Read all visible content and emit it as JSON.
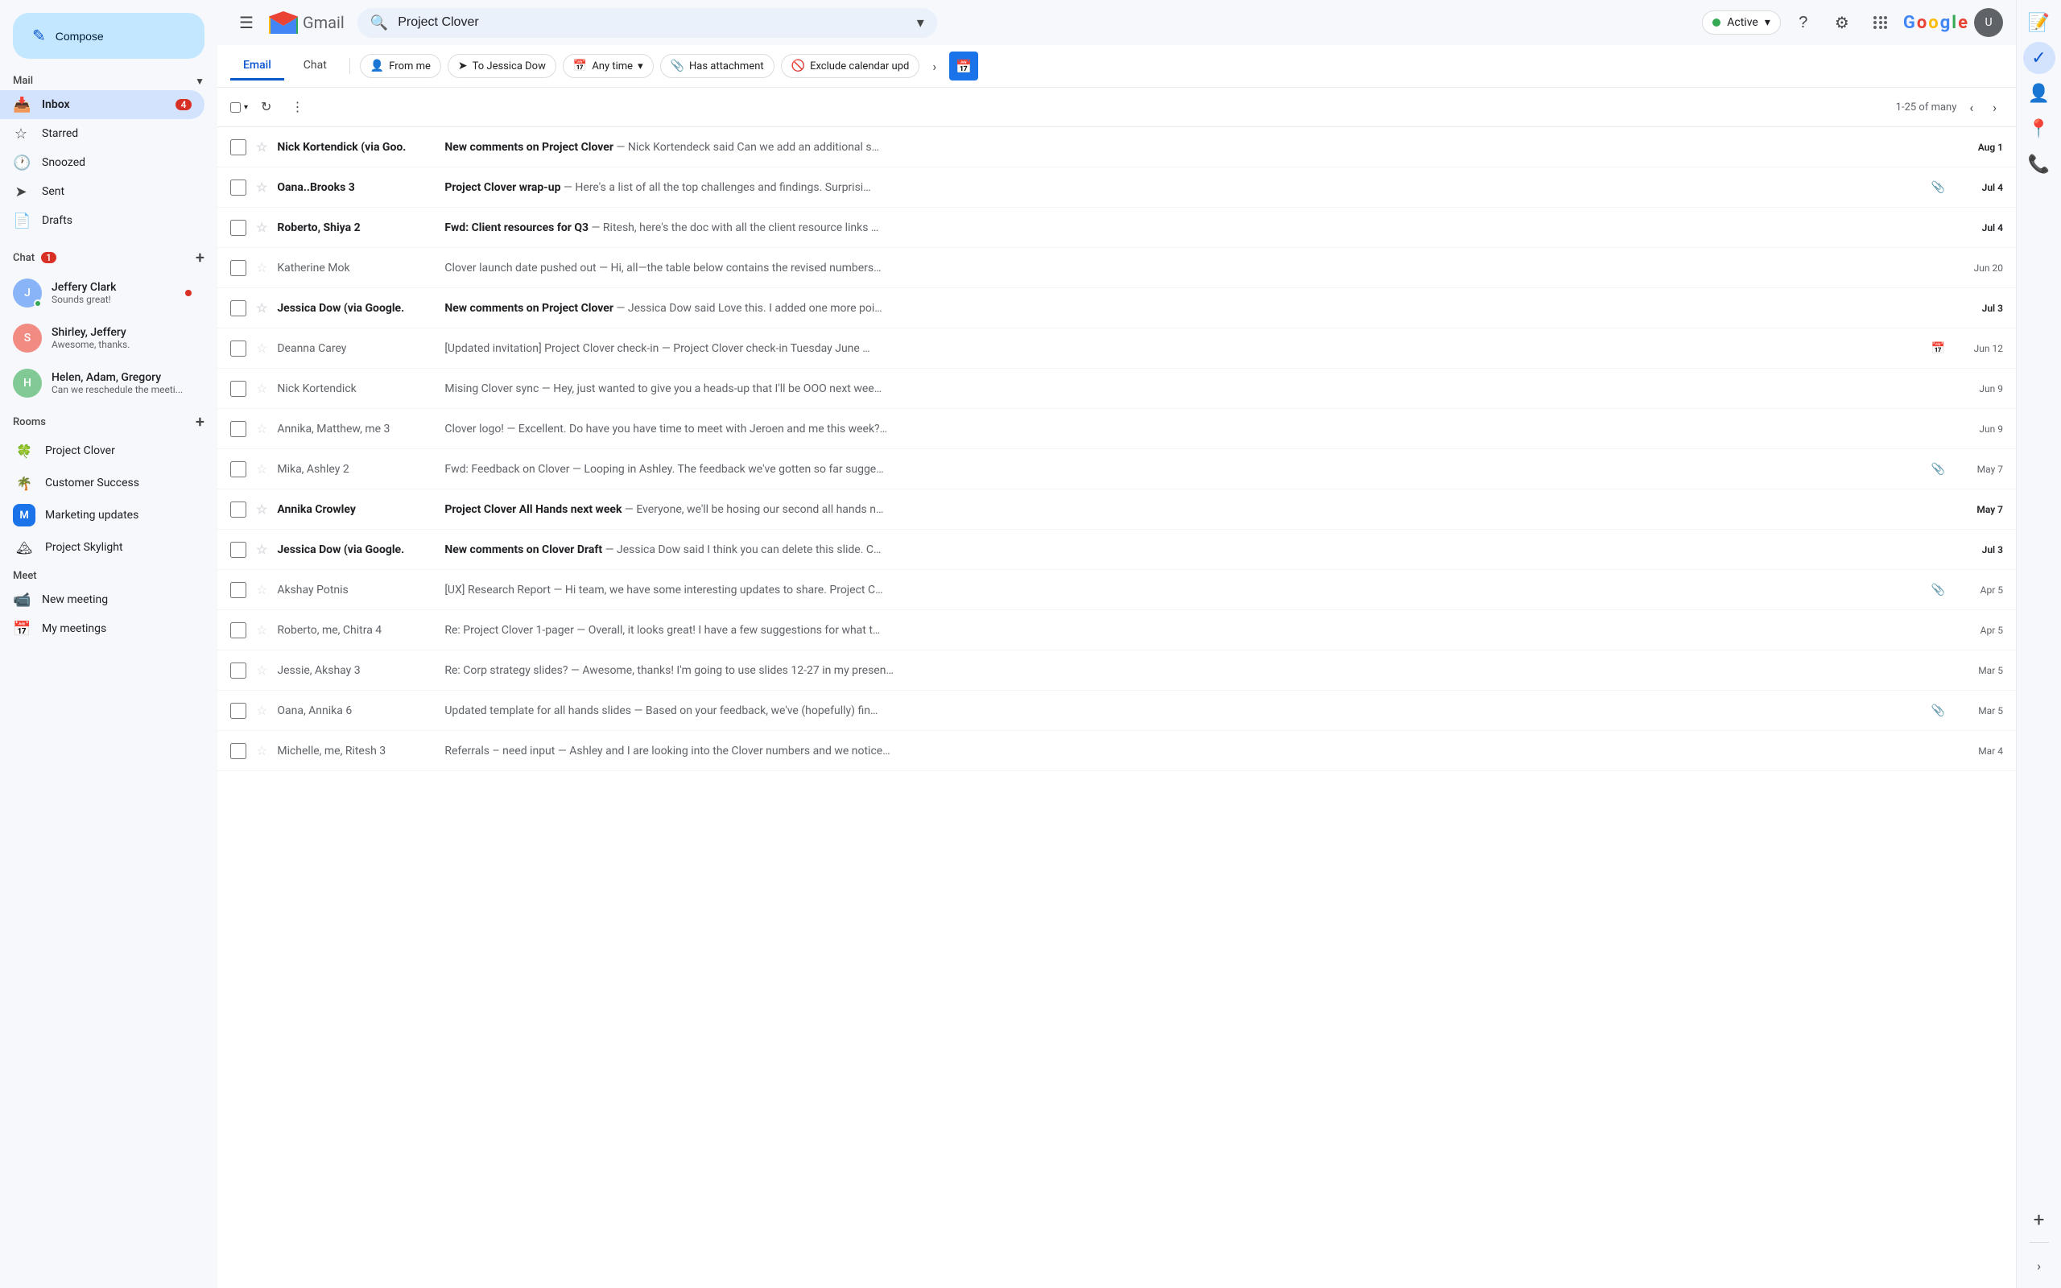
{
  "app": {
    "title": "Gmail",
    "logo_letter": "M"
  },
  "header": {
    "search_placeholder": "Project Clover",
    "search_value": "Project Clover",
    "status_label": "Active",
    "help_icon": "?",
    "settings_icon": "⚙",
    "user_initials": "U"
  },
  "compose": {
    "label": "Compose",
    "icon": "✎"
  },
  "nav": {
    "mail_section": "Mail",
    "items": [
      {
        "id": "inbox",
        "label": "Inbox",
        "icon": "📥",
        "badge": "4",
        "active": true
      },
      {
        "id": "starred",
        "label": "Starred",
        "icon": "☆",
        "badge": ""
      },
      {
        "id": "snoozed",
        "label": "Snoozed",
        "icon": "🕐",
        "badge": ""
      },
      {
        "id": "sent",
        "label": "Sent",
        "icon": "➤",
        "badge": ""
      },
      {
        "id": "drafts",
        "label": "Drafts",
        "icon": "📄",
        "badge": ""
      }
    ]
  },
  "chat_section": {
    "label": "Chat",
    "badge": "1",
    "items": [
      {
        "id": "jeffery",
        "name": "Jeffery Clark",
        "preview": "Sounds great!",
        "avatar_color": "#8ab4f8",
        "has_dot": true,
        "unread": true
      },
      {
        "id": "shirley",
        "name": "Shirley, Jeffery",
        "preview": "Awesome, thanks.",
        "avatar_color": "#f28b82",
        "has_dot": false,
        "unread": false
      },
      {
        "id": "helen",
        "name": "Helen, Adam, Gregory",
        "preview": "Can we reschedule the meeti...",
        "avatar_color": "#81c995",
        "has_dot": false,
        "unread": false
      }
    ]
  },
  "rooms_section": {
    "label": "Rooms",
    "items": [
      {
        "id": "project-clover",
        "name": "Project Clover",
        "emoji": "🍀"
      },
      {
        "id": "customer-success",
        "name": "Customer Success",
        "emoji": "🌴"
      },
      {
        "id": "marketing-updates",
        "name": "Marketing updates",
        "letter": "M",
        "color": "#1a73e8"
      },
      {
        "id": "project-skylight",
        "name": "Project Skylight",
        "emoji": "🏔"
      }
    ]
  },
  "meet_section": {
    "label": "Meet",
    "items": [
      {
        "id": "new-meeting",
        "label": "New meeting",
        "icon": "📹"
      },
      {
        "id": "my-meetings",
        "label": "My meetings",
        "icon": "📅"
      }
    ]
  },
  "filters": {
    "tabs": [
      {
        "id": "email",
        "label": "Email",
        "active": true
      },
      {
        "id": "chat",
        "label": "Chat",
        "active": false
      }
    ],
    "chips": [
      {
        "id": "from-me",
        "label": "From me",
        "icon": "👤"
      },
      {
        "id": "to-jessica",
        "label": "To Jessica Dow",
        "icon": "➤"
      },
      {
        "id": "any-time",
        "label": "Any time",
        "icon": "📅",
        "has_arrow": true
      },
      {
        "id": "has-attachment",
        "label": "Has attachment",
        "icon": "📎"
      },
      {
        "id": "exclude-calendar",
        "label": "Exclude calendar upd",
        "icon": "🚫"
      },
      {
        "id": "more",
        "label": "›"
      }
    ]
  },
  "toolbar": {
    "select_label": "",
    "refresh_icon": "↻",
    "more_icon": "⋮",
    "pagination": "1-25 of many",
    "prev_icon": "‹",
    "next_icon": "›"
  },
  "emails": [
    {
      "id": 1,
      "sender": "Nick Kortendick (via Goo.",
      "subject": "New comments on Project Clover",
      "preview": "— Nick Kortendeck said Can we add an additional s…",
      "date": "Aug 1",
      "unread": true,
      "starred": false,
      "attachment": false,
      "calendar": false
    },
    {
      "id": 2,
      "sender": "Oana..Brooks 3",
      "subject": "Project Clover wrap-up",
      "preview": "— Here's a list of all the top challenges and findings. Surprisi…",
      "date": "Jul 4",
      "unread": true,
      "starred": false,
      "attachment": true,
      "calendar": false
    },
    {
      "id": 3,
      "sender": "Roberto, Shiya 2",
      "subject": "Fwd: Client resources for Q3",
      "preview": "— Ritesh, here's the doc with all the client resource links …",
      "date": "Jul 4",
      "unread": true,
      "starred": false,
      "attachment": false,
      "calendar": false
    },
    {
      "id": 4,
      "sender": "Katherine Mok",
      "subject": "Clover launch date pushed out",
      "preview": "— Hi, all—the table below contains the revised numbers…",
      "date": "Jun 20",
      "unread": false,
      "starred": false,
      "attachment": false,
      "calendar": false
    },
    {
      "id": 5,
      "sender": "Jessica Dow (via Google.",
      "subject": "New comments on Project Clover",
      "preview": "— Jessica Dow said Love this. I added one more poi…",
      "date": "Jul 3",
      "unread": true,
      "starred": false,
      "attachment": false,
      "calendar": false
    },
    {
      "id": 6,
      "sender": "Deanna Carey",
      "subject": "[Updated invitation] Project Clover check-in",
      "preview": "— Project Clover check-in Tuesday June …",
      "date": "Jun 12",
      "unread": false,
      "starred": false,
      "attachment": false,
      "calendar": true
    },
    {
      "id": 7,
      "sender": "Nick Kortendick",
      "subject": "Mising Clover sync",
      "preview": "— Hey, just wanted to give you a heads-up that I'll be OOO next wee…",
      "date": "Jun 9",
      "unread": false,
      "starred": false,
      "attachment": false,
      "calendar": false
    },
    {
      "id": 8,
      "sender": "Annika, Matthew, me 3",
      "subject": "Clover logo!",
      "preview": "— Excellent. Do have you have time to meet with Jeroen and me this week?…",
      "date": "Jun 9",
      "unread": false,
      "starred": false,
      "attachment": false,
      "calendar": false
    },
    {
      "id": 9,
      "sender": "Mika, Ashley 2",
      "subject": "Fwd: Feedback on Clover",
      "preview": "— Looping in Ashley. The feedback we've gotten so far sugge…",
      "date": "May 7",
      "unread": false,
      "starred": false,
      "attachment": true,
      "calendar": false
    },
    {
      "id": 10,
      "sender": "Annika Crowley",
      "subject": "Project Clover All Hands next week",
      "preview": "— Everyone, we'll be hosing our second all hands n…",
      "date": "May 7",
      "unread": true,
      "starred": false,
      "attachment": false,
      "calendar": false
    },
    {
      "id": 11,
      "sender": "Jessica Dow (via Google.",
      "subject": "New comments on Clover Draft",
      "preview": "— Jessica Dow said I think you can delete this slide. C…",
      "date": "Jul 3",
      "unread": true,
      "starred": false,
      "attachment": false,
      "calendar": false
    },
    {
      "id": 12,
      "sender": "Akshay Potnis",
      "subject": "[UX] Research Report",
      "preview": "— Hi team, we have some interesting updates to share. Project C…",
      "date": "Apr 5",
      "unread": false,
      "starred": false,
      "attachment": true,
      "calendar": false
    },
    {
      "id": 13,
      "sender": "Roberto, me, Chitra 4",
      "subject": "Re: Project Clover 1-pager",
      "preview": "— Overall, it looks great! I have a few suggestions for what t…",
      "date": "Apr 5",
      "unread": false,
      "starred": false,
      "attachment": false,
      "calendar": false
    },
    {
      "id": 14,
      "sender": "Jessie, Akshay 3",
      "subject": "Re: Corp strategy slides?",
      "preview": "— Awesome, thanks! I'm going to use slides 12-27 in my presen…",
      "date": "Mar 5",
      "unread": false,
      "starred": false,
      "attachment": false,
      "calendar": false
    },
    {
      "id": 15,
      "sender": "Oana, Annika 6",
      "subject": "Updated template for all hands slides",
      "preview": "— Based on your feedback, we've (hopefully) fin…",
      "date": "Mar 5",
      "unread": false,
      "starred": false,
      "attachment": true,
      "calendar": false
    },
    {
      "id": 16,
      "sender": "Michelle, me, Ritesh 3",
      "subject": "Referrals – need input",
      "preview": "— Ashley and I are looking into the Clover numbers and we notice…",
      "date": "Mar 4",
      "unread": false,
      "starred": false,
      "attachment": false,
      "calendar": false
    }
  ],
  "right_sidebar": {
    "icons": [
      {
        "id": "keep",
        "symbol": "📝",
        "active": false
      },
      {
        "id": "tasks",
        "symbol": "✓",
        "active": true
      },
      {
        "id": "contacts",
        "symbol": "👤",
        "active": false
      },
      {
        "id": "maps",
        "symbol": "🗺",
        "active": false
      },
      {
        "id": "phone",
        "symbol": "📞",
        "active": false
      },
      {
        "id": "add",
        "symbol": "+",
        "active": false
      }
    ]
  }
}
